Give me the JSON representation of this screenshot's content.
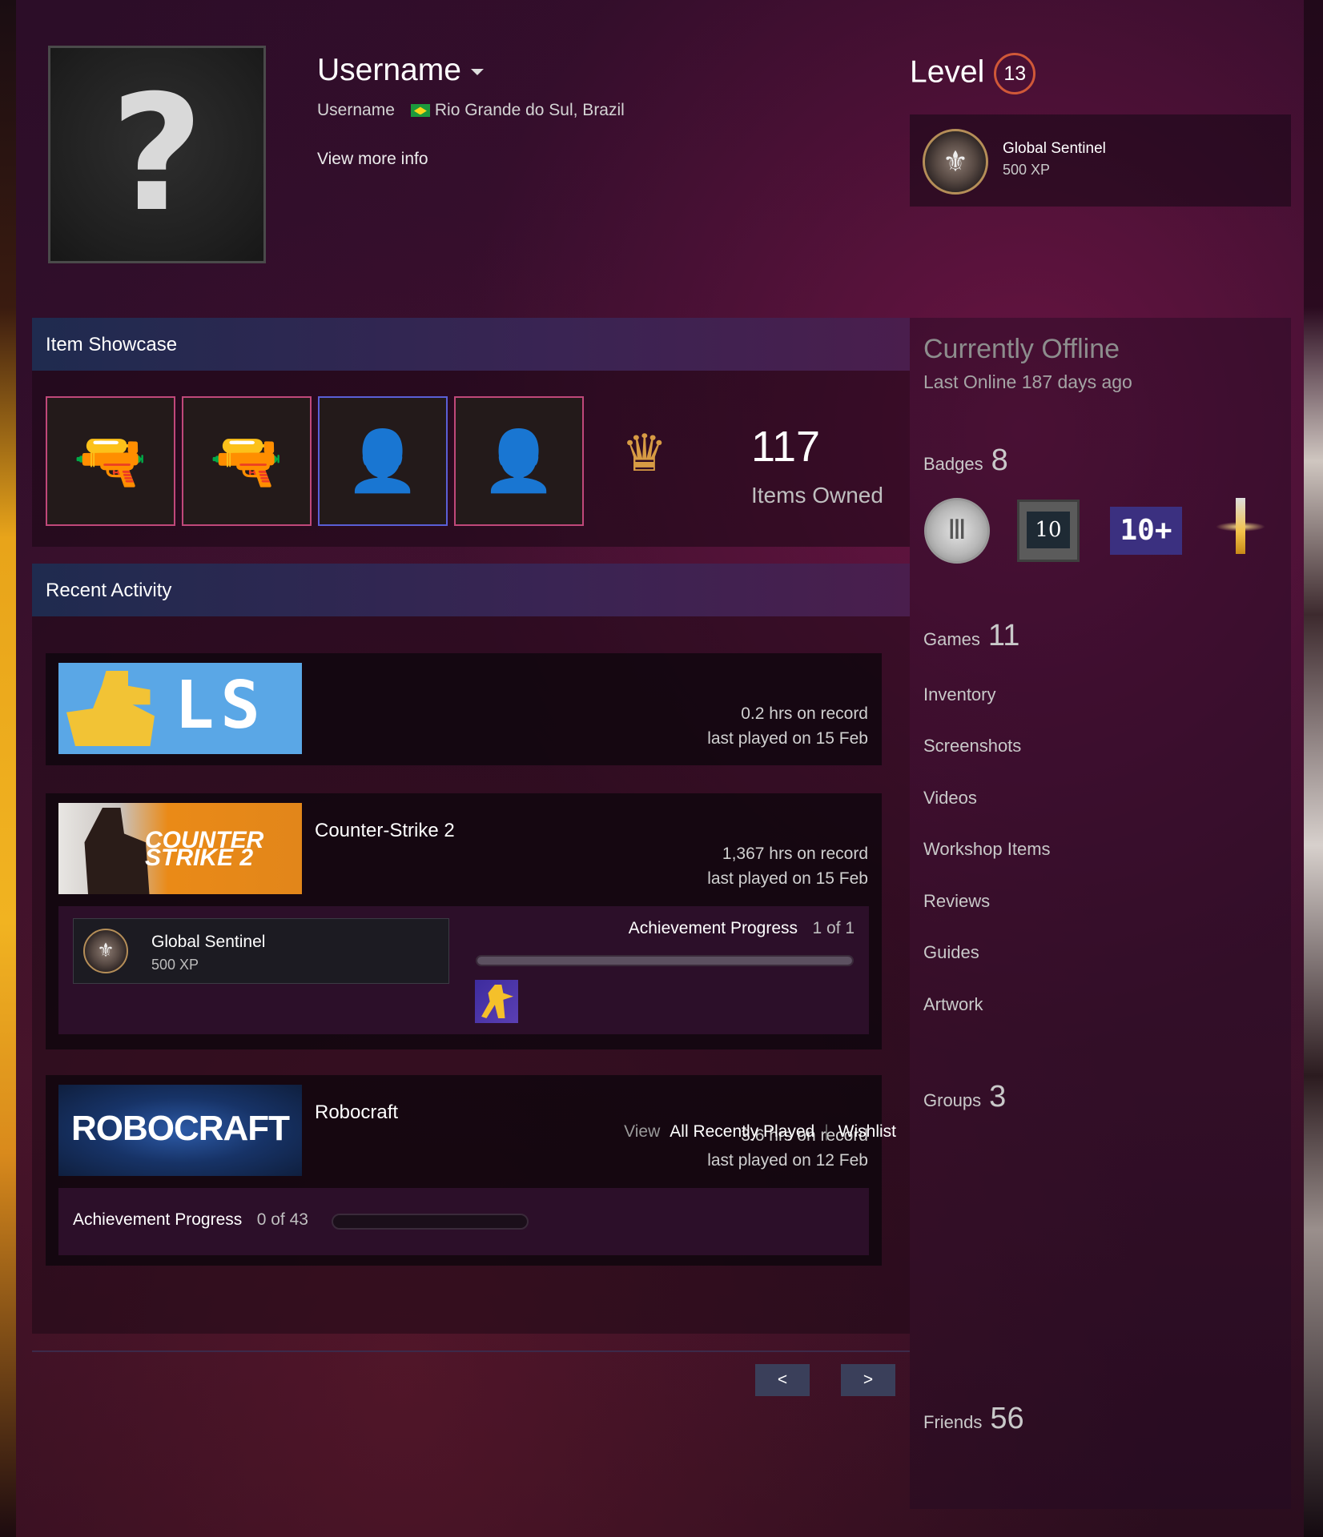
{
  "profile": {
    "persona_name": "Username",
    "real_name": "Username",
    "location": "Rio Grande do Sul, Brazil",
    "view_more": "View more info",
    "avatar_icon": "question-mark-icon"
  },
  "level": {
    "label": "Level",
    "value": "13",
    "badge": {
      "name": "Global Sentinel",
      "xp": "500 XP",
      "icon": "global-sentinel-medal-icon"
    }
  },
  "item_showcase": {
    "title": "Item Showcase",
    "items": [
      {
        "icon": "desert-eagle-pistol-icon",
        "border": "#c0487a"
      },
      {
        "icon": "silenced-pistol-icon",
        "border": "#c0487a"
      },
      {
        "icon": "soldier-agent-icon",
        "border": "#5a5fd6"
      },
      {
        "icon": "mercenary-agent-icon",
        "border": "#c0487a"
      }
    ],
    "crown_icon": "crowned-skull-icon",
    "count": "117",
    "count_label": "Items Owned"
  },
  "recent_activity": {
    "title": "Recent Activity",
    "games": [
      {
        "name": "",
        "capsule_text": "LS",
        "hours": "0.2 hrs on record",
        "last_played": "last played on 15 Feb"
      },
      {
        "name": "Counter-Strike 2",
        "capsule_text": "COUNTER STRIKE 2",
        "hours": "1,367 hrs on record",
        "last_played": "last played on 15 Feb",
        "achievement_item": {
          "name": "Global Sentinel",
          "xp": "500 XP"
        },
        "achievement_progress": {
          "label": "Achievement Progress",
          "count": "1 of 1",
          "fraction": 1.0
        }
      },
      {
        "name": "Robocraft",
        "capsule_text": "ROBOCRAFT",
        "hours": "3.6 hrs on record",
        "last_played": "last played on 12 Feb",
        "achievement_progress": {
          "label": "Achievement Progress",
          "count": "0 of 43",
          "fraction": 0.0
        }
      }
    ],
    "footer": {
      "view": "View",
      "all_recent": "All Recently Played",
      "wishlist": "Wishlist"
    }
  },
  "pager": {
    "prev": "<",
    "next": ">"
  },
  "sidebar": {
    "status": "Currently Offline",
    "last_online": "Last Online 187 days ago",
    "badges": {
      "label": "Badges",
      "count": "8",
      "b2_text": "10",
      "b3_text": "10+"
    },
    "games": {
      "label": "Games",
      "count": "11"
    },
    "links": [
      "Inventory",
      "Screenshots",
      "Videos",
      "Workshop Items",
      "Reviews",
      "Guides",
      "Artwork"
    ],
    "groups": {
      "label": "Groups",
      "count": "3"
    },
    "friends": {
      "label": "Friends",
      "count": "56"
    }
  },
  "colors": {
    "accent_level": "#d05838",
    "showcase_border": "#c0487a",
    "showcase_border_alt": "#5a5fd6"
  }
}
